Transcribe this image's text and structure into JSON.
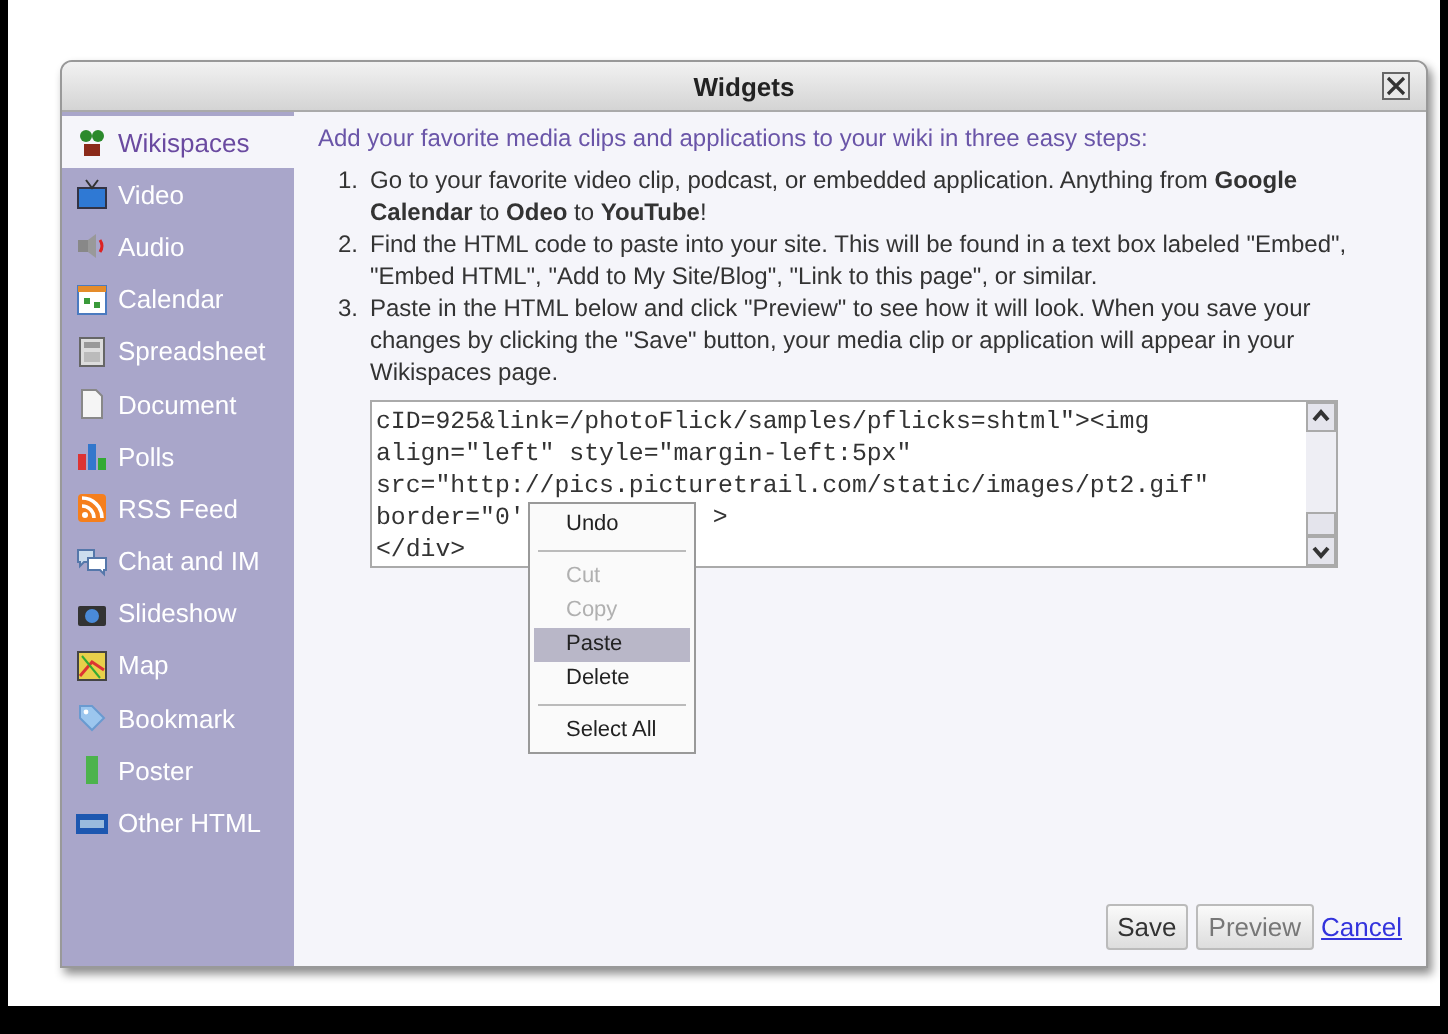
{
  "dialog": {
    "title": "Widgets"
  },
  "sidebar": {
    "items": [
      {
        "label": "Wikispaces",
        "selected": true
      },
      {
        "label": "Video",
        "selected": false
      },
      {
        "label": "Audio",
        "selected": false
      },
      {
        "label": "Calendar",
        "selected": false
      },
      {
        "label": "Spreadsheet",
        "selected": false
      },
      {
        "label": "Document",
        "selected": false
      },
      {
        "label": "Polls",
        "selected": false
      },
      {
        "label": "RSS Feed",
        "selected": false
      },
      {
        "label": "Chat and IM",
        "selected": false
      },
      {
        "label": "Slideshow",
        "selected": false
      },
      {
        "label": "Map",
        "selected": false
      },
      {
        "label": "Bookmark",
        "selected": false
      },
      {
        "label": "Poster",
        "selected": false
      },
      {
        "label": "Other HTML",
        "selected": false
      }
    ]
  },
  "intro": "Add your favorite media clips and applications to your wiki in three easy steps:",
  "steps": [
    {
      "number": "1.",
      "text": "Go to your favorite video clip, podcast, or embedded application. Anything from **Google Calendar** to **Odeo** to **YouTube**!"
    },
    {
      "number": "2.",
      "text": "Find the HTML code to paste into your site. This will be found in a text box labeled \"Embed\", \"Embed HTML\", \"Add to My Site/Blog\", \"Link to this page\", or similar."
    },
    {
      "number": "3.",
      "text": "Paste in the HTML below and click \"Preview\" to see how it will look. When you save your changes by clicking the \"Save\" button, your media clip or application will appear in your Wikispaces page."
    }
  ],
  "code_box": {
    "lines": [
      {
        "text": "cID=925&link=/photoFlick/samples/pflicks=shtml\"><img"
      },
      {
        "text": "align=\"left\" style=\"margin-left:5px\""
      },
      {
        "text": "src=\"http://pics.picturetrail.com/static/images/pt2.gif\""
      },
      {
        "text": "border=\"0'",
        "tail": ">"
      },
      {
        "text": "</div>"
      }
    ]
  },
  "context_menu": {
    "items": [
      {
        "kind": "item",
        "label": "Undo",
        "disabled": false,
        "selected": false
      },
      {
        "kind": "separator"
      },
      {
        "kind": "item",
        "label": "Cut",
        "disabled": true,
        "selected": false
      },
      {
        "kind": "item",
        "label": "Copy",
        "disabled": true,
        "selected": false
      },
      {
        "kind": "item",
        "label": "Paste",
        "disabled": false,
        "selected": true
      },
      {
        "kind": "item",
        "label": "Delete",
        "disabled": false,
        "selected": false
      },
      {
        "kind": "separator"
      },
      {
        "kind": "item",
        "label": "Select All",
        "disabled": false,
        "selected": false
      }
    ]
  },
  "buttons": [
    {
      "kind": "button",
      "label": "Save",
      "disabled": false
    },
    {
      "kind": "button",
      "label": "Preview",
      "disabled": true
    },
    {
      "kind": "link",
      "label": "Cancel",
      "disabled": false
    }
  ]
}
